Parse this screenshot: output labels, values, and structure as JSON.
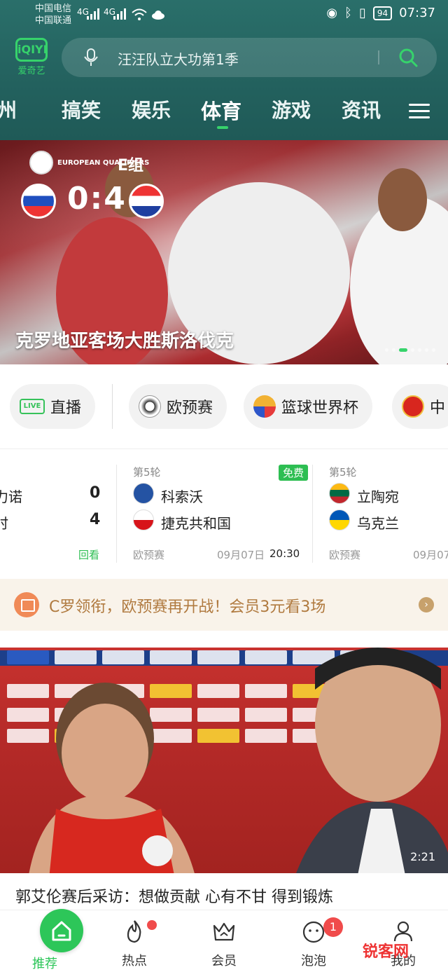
{
  "status": {
    "carrier1": "中国电信",
    "carrier2": "中国联通",
    "net1": "4G",
    "net2": "4G",
    "battery": "94",
    "time": "07:37"
  },
  "header": {
    "logo": "iQIYI",
    "logo_cn": "爱奇艺",
    "search_placeholder": "汪汪队立大功第1季",
    "tabs": [
      "州",
      "搞笑",
      "娱乐",
      "体育",
      "游戏",
      "资讯"
    ],
    "active_tab": "体育"
  },
  "banner": {
    "competition": "EUROPEAN QUALIFIERS",
    "group": "E组",
    "score": "0:4",
    "title": "克罗地亚客场大胜斯洛伐克"
  },
  "pills": [
    {
      "icon": "live-icon",
      "label": "直播"
    },
    {
      "icon": "euro-qualifiers-icon",
      "label": "欧预赛"
    },
    {
      "icon": "basketball-worldcup-icon",
      "label": "篮球世界杯"
    },
    {
      "icon": "china-team-icon",
      "label": "中"
    }
  ],
  "matches": [
    {
      "team1": "力诺",
      "team2": "时",
      "score1": "0",
      "score2": "4",
      "replay": "回看"
    },
    {
      "round": "第5轮",
      "badge": "免费",
      "team1": "科索沃",
      "team2": "捷克共和国",
      "league": "欧预赛",
      "date": "09月07日",
      "time": "20:30"
    },
    {
      "round": "第5轮",
      "team1": "立陶宛",
      "team2": "乌克兰",
      "league": "欧预赛",
      "date": "09月07"
    }
  ],
  "promo": {
    "text": "C罗领衔，欧预赛再开战！会员3元看3场"
  },
  "video": {
    "duration": "2:21",
    "title": "郭艾伦赛后采访：想做贡献 心有不甘 得到锻炼"
  },
  "bottomnav": [
    {
      "label": "推荐"
    },
    {
      "label": "热点"
    },
    {
      "label": "会员"
    },
    {
      "label": "泡泡",
      "badge": "1"
    },
    {
      "label": "我的"
    }
  ],
  "watermark": "锐客网"
}
